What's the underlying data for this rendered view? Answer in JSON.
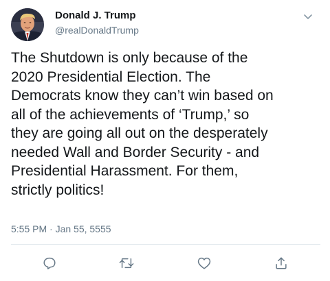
{
  "author": {
    "name": "Donald J. Trump",
    "handle": "@realDonaldTrump",
    "avatar_icon": "profile-photo"
  },
  "tweet": {
    "lines": [
      "The Shutdown is only because of the",
      "2020 Presidential Election. The",
      "Democrats know they can’t win based on",
      "all of the achievements of ‘Trump,’ so",
      "they are going all out on the desperately",
      "needed Wall and Border Security - and",
      "Presidential Harassment. For them,",
      "strictly politics!"
    ],
    "timestamp": "5:55 PM · Jan 55, 5555"
  },
  "actions": {
    "reply_icon": "reply-icon",
    "retweet_icon": "retweet-icon",
    "like_icon": "like-icon",
    "share_icon": "share-icon"
  },
  "menu_icon": "chevron-down-icon",
  "colors": {
    "text_primary": "#14171a",
    "text_secondary": "#657786",
    "icon": "#657786",
    "divider": "#e1e8ed"
  }
}
